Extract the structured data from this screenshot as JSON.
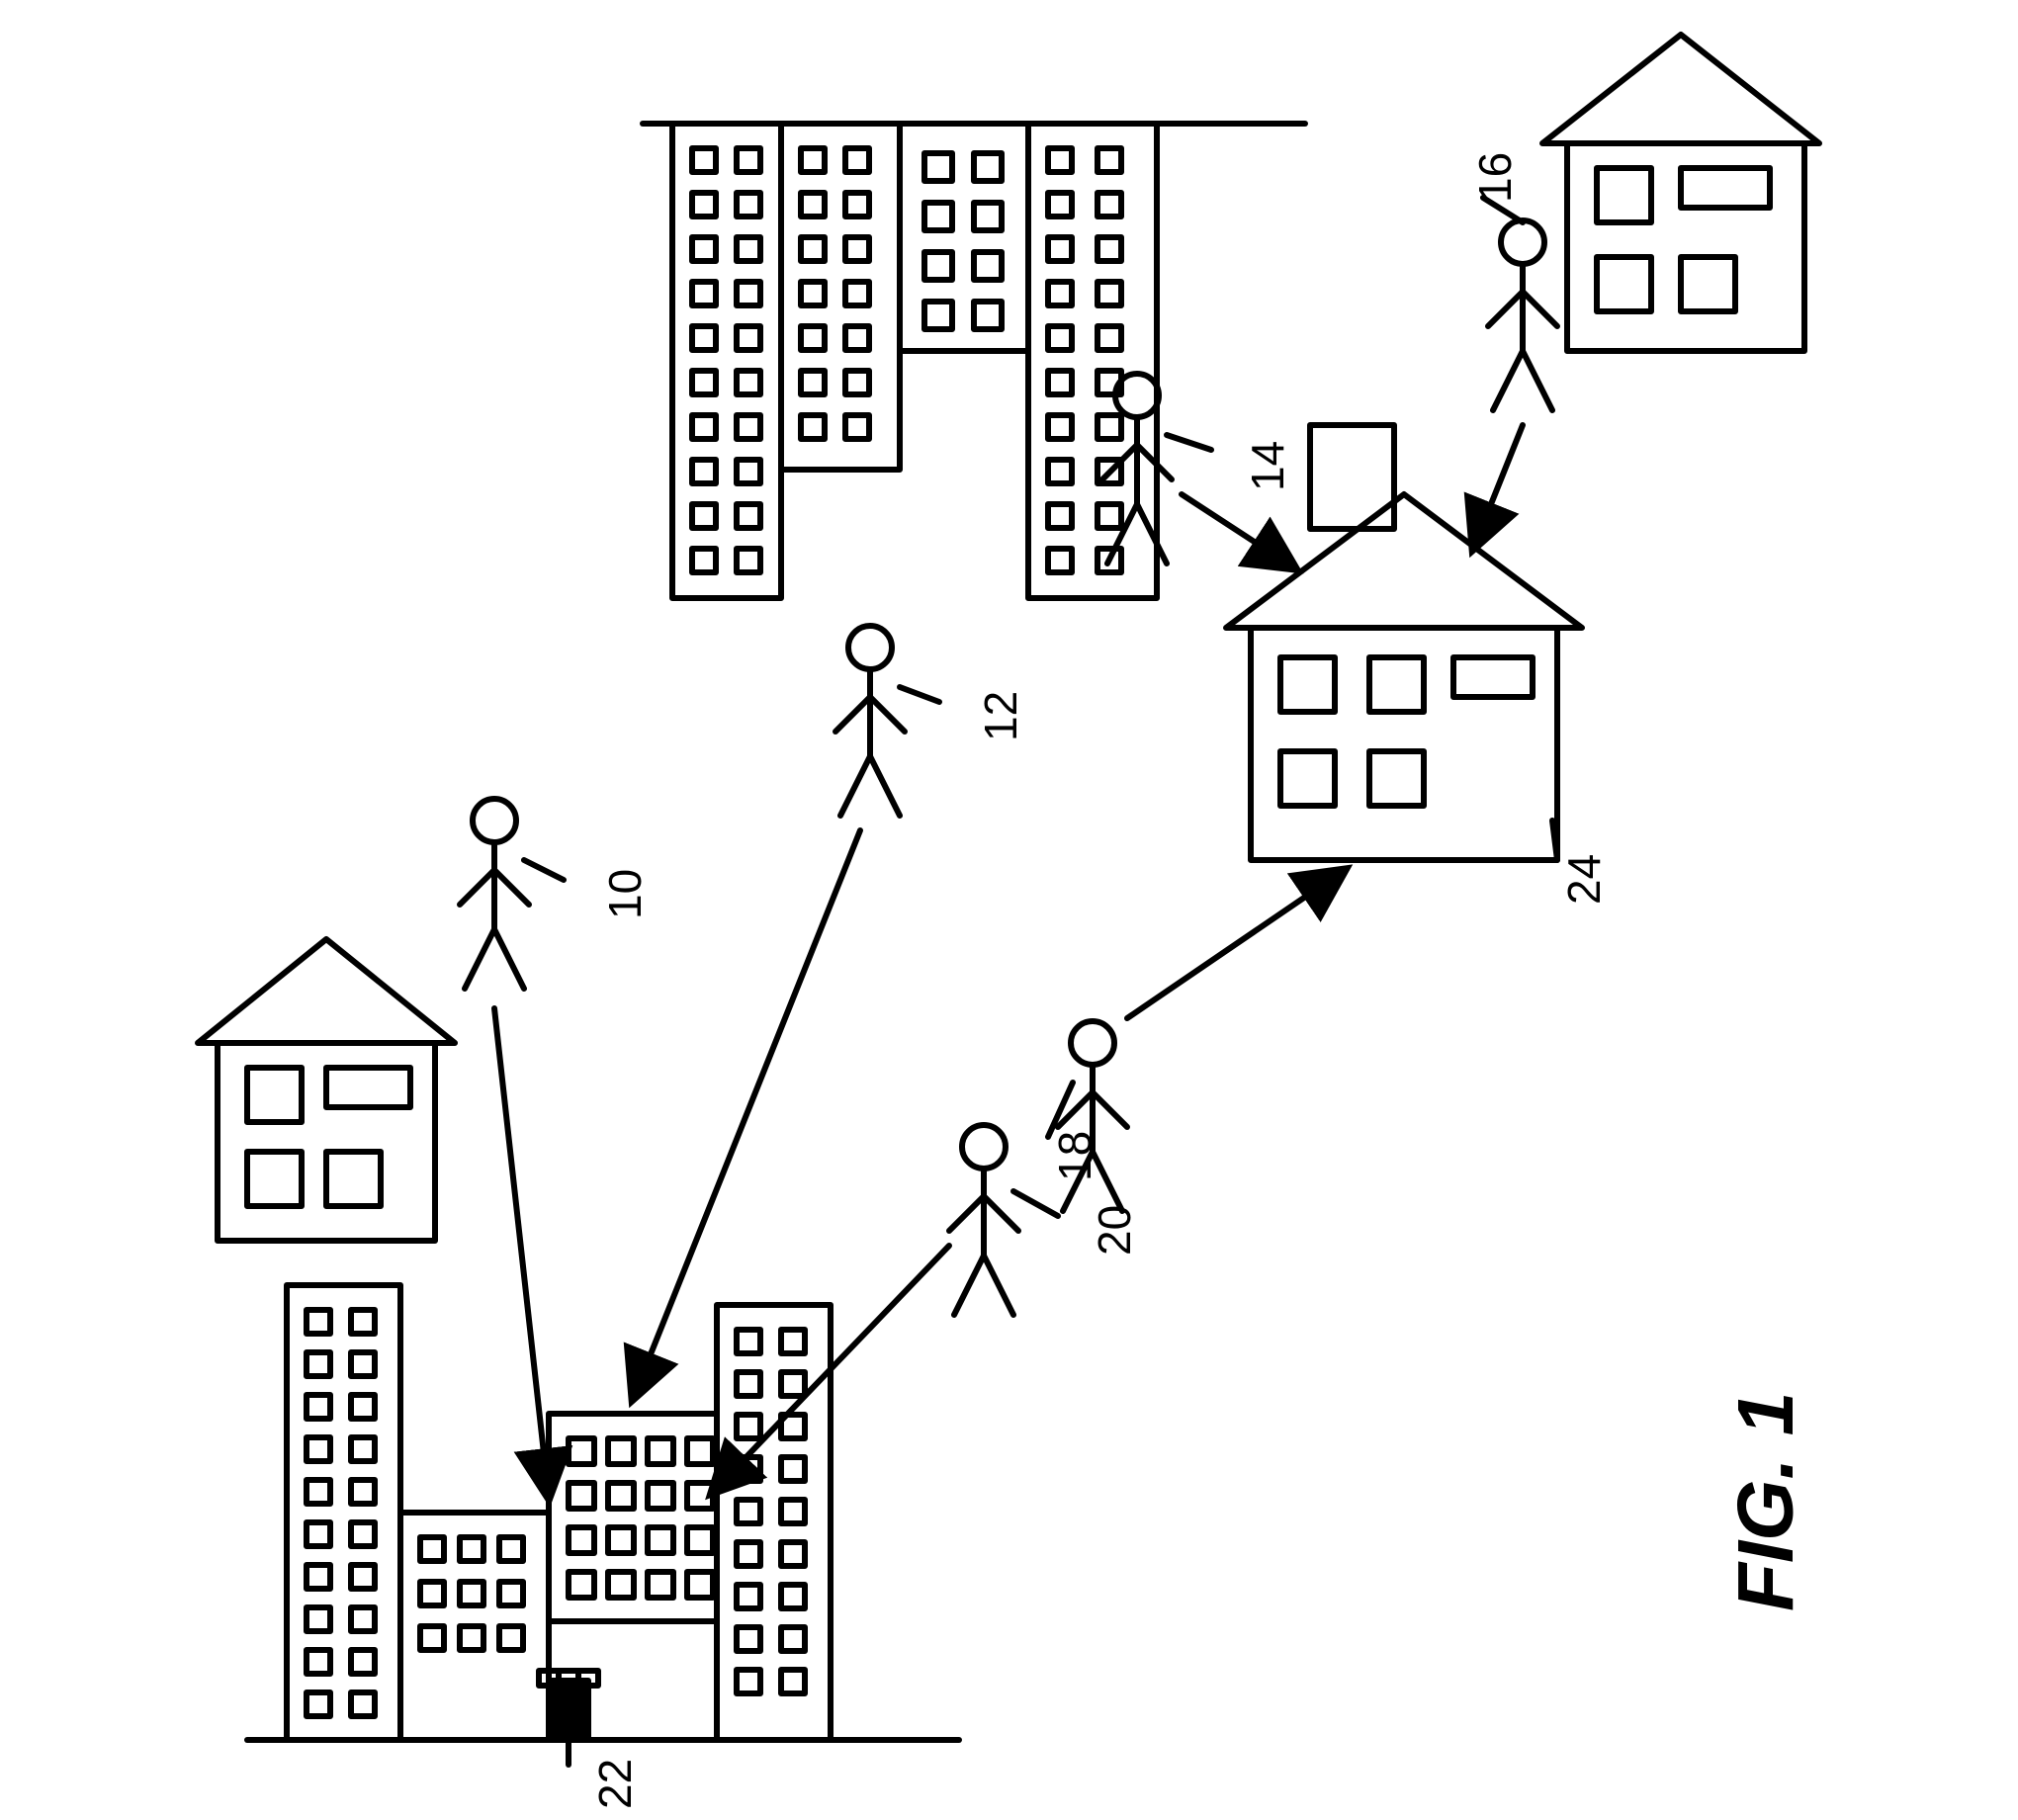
{
  "figure_caption": "FIG. 1",
  "labels": {
    "p10": "10",
    "p12": "12",
    "p14": "14",
    "p16": "16",
    "p18": "18",
    "p20": "20",
    "b22": "22",
    "b24": "24"
  }
}
